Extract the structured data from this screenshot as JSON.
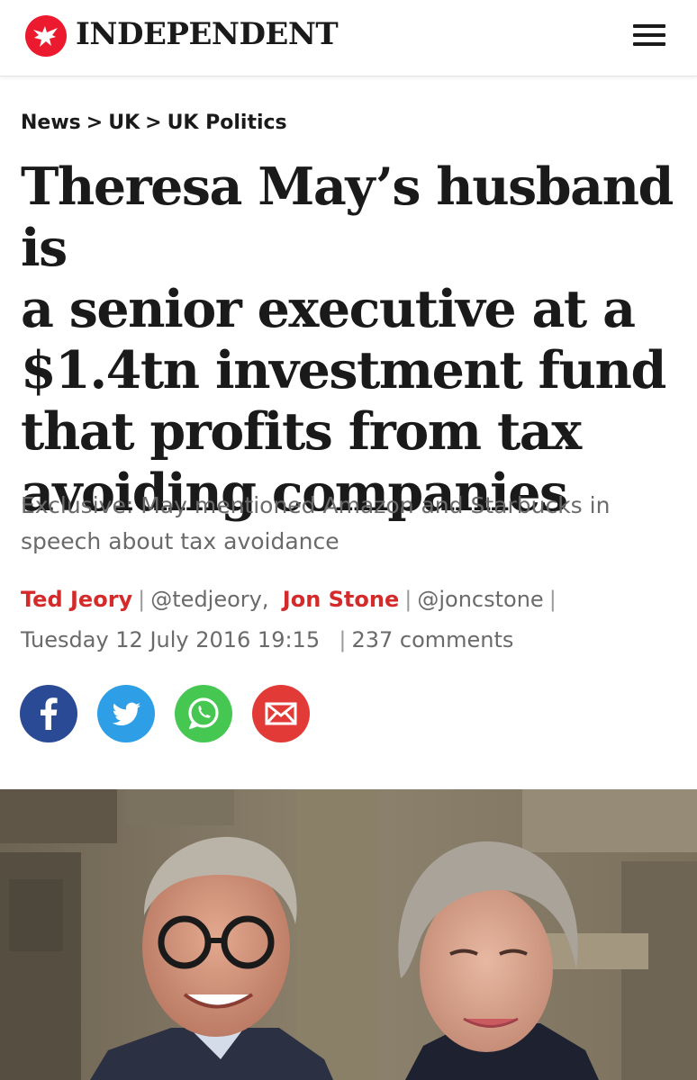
{
  "header": {
    "wordmark": "INDEPENDENT",
    "logo_icon": "eagle-icon",
    "menu_icon": "hamburger-icon",
    "brand_color": "#ec1a2e"
  },
  "breadcrumb": {
    "items": [
      "News",
      "UK",
      "UK Politics"
    ],
    "separator": ">"
  },
  "article": {
    "headline_lines": [
      "Theresa May’s husband is",
      "a senior executive at a",
      "$1.4tn investment fund",
      "that profits from tax",
      "avoiding companies"
    ],
    "standfirst": "Exclusive: May mentioned Amazon and Starbucks in speech about tax avoidance",
    "authors": [
      {
        "name": "Ted Jeory",
        "handle": "@tedjeory"
      },
      {
        "name": "Jon Stone",
        "handle": "@joncstone"
      }
    ],
    "handle_separator": ",",
    "date": "Tuesday 12 July 2016 19:15",
    "comments": "237 comments",
    "author_color": "#d42a2a"
  },
  "share": {
    "buttons": [
      {
        "name": "facebook",
        "icon": "facebook-icon",
        "color": "#2b4a95"
      },
      {
        "name": "twitter",
        "icon": "twitter-icon",
        "color": "#2e9fe6"
      },
      {
        "name": "whatsapp",
        "icon": "whatsapp-icon",
        "color": "#46c752"
      },
      {
        "name": "email",
        "icon": "email-icon",
        "color": "#e23a36"
      }
    ]
  }
}
